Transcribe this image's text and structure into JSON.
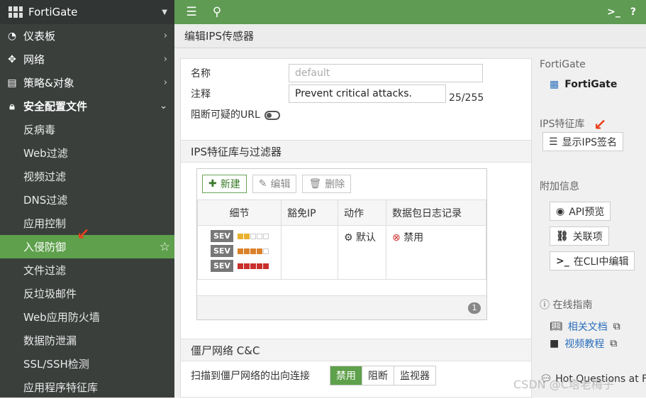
{
  "sidebar": {
    "title": "FortiGate",
    "items": [
      {
        "icon": "dashboard-icon",
        "label": "仪表板"
      },
      {
        "icon": "network-icon",
        "label": "网络"
      },
      {
        "icon": "policy-icon",
        "label": "策略&对象"
      },
      {
        "icon": "lock-icon",
        "label": "安全配置文件"
      }
    ],
    "subitems": [
      "反病毒",
      "Web过滤",
      "视频过滤",
      "DNS过滤",
      "应用控制",
      "入侵防御",
      "文件过滤",
      "反垃圾邮件",
      "Web应用防火墙",
      "数据防泄漏",
      "SSL/SSH检测",
      "应用程序特征库"
    ]
  },
  "topbar": {
    "menu_icon": "hamburger-icon",
    "search_icon": "search-icon",
    "cli_label": ">_",
    "help_label": "?"
  },
  "page": {
    "title": "编辑IPS传感器"
  },
  "form": {
    "name_label": "名称",
    "name_placeholder": "default",
    "comment_label": "注释",
    "comment_value": "Prevent critical attacks.",
    "comment_count": "25/255",
    "block_url_label": "阻断可疑的URL",
    "filters_section": "IPS特征库与过滤器",
    "buttons": {
      "new": "新建",
      "edit": "编辑",
      "delete": "删除"
    },
    "columns": [
      "细节",
      "豁免IP",
      "动作",
      "数据包日志记录"
    ],
    "row": {
      "sev": "SEV",
      "action": "默认",
      "log": "禁用"
    },
    "count": "1",
    "botnet_section": "僵尸网络 C&C",
    "botnet_label": "扫描到僵尸网络的出向连接",
    "botnet_options": [
      "禁用",
      "阻断",
      "监视器"
    ]
  },
  "right": {
    "device_label": "FortiGate",
    "device_name": "FortiGate",
    "ips_label": "IPS特征库",
    "show_sig": "显示IPS签名",
    "extra_label": "附加信息",
    "api_preview": "API预览",
    "related": "关联项",
    "cli_edit": "在CLI中编辑",
    "guide_label": "在线指南",
    "docs": "相关文档",
    "video": "视频教程",
    "hot": "Hot Questions at Fo"
  },
  "watermark": "CSDN @C塔老梅子",
  "colors": {
    "accent": "#5ea04b",
    "sidebar": "#3a3f3c",
    "arrow": "#e8401c",
    "sev_low": "#e8b130",
    "sev_med": "#d9822b",
    "sev_high": "#c9302c"
  }
}
